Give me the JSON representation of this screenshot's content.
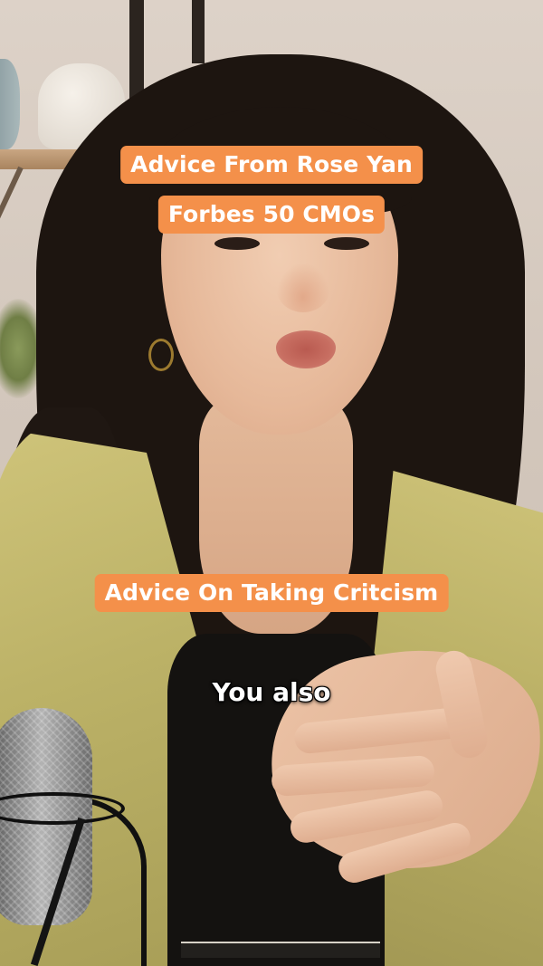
{
  "captions": {
    "title": "Advice From Rose Yan",
    "credential": "Forbes 50 CMOs",
    "topic": "Advice On Taking Critcism"
  },
  "subtitle": {
    "text": "You also"
  },
  "colors": {
    "badge_background": "#f4904a",
    "caption_text": "#ffffff"
  }
}
